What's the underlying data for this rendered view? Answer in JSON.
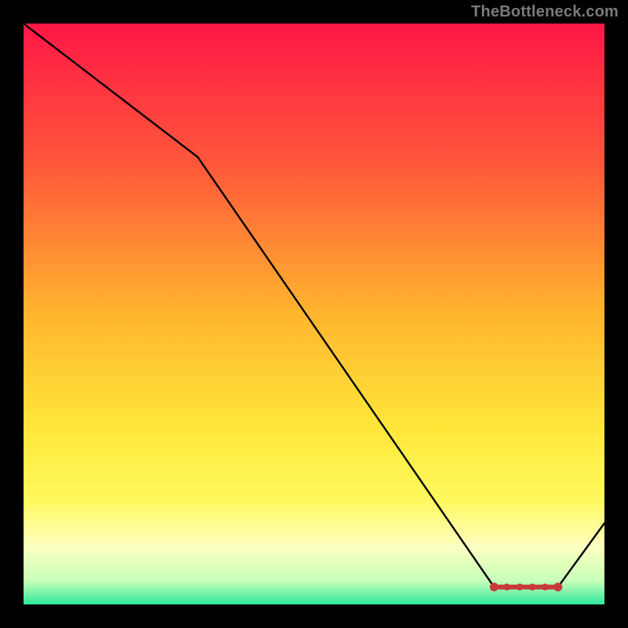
{
  "watermark": "TheBottleneck.com",
  "chart_data": {
    "type": "line",
    "title": "",
    "xlabel": "",
    "ylabel": "",
    "xlim": [
      0,
      100
    ],
    "ylim": [
      0,
      100
    ],
    "grid": false,
    "series": [
      {
        "name": "curve",
        "color": "#000000",
        "x": [
          0,
          30,
          81,
          92,
          100
        ],
        "y": [
          100,
          77,
          3,
          3,
          14
        ]
      },
      {
        "name": "markers",
        "color": "#c83a3a",
        "kind": "capsule",
        "x_range": [
          81,
          92
        ],
        "y": 3
      }
    ],
    "background_gradient": {
      "stops": [
        {
          "offset": 0.0,
          "color": "#ff1746"
        },
        {
          "offset": 0.25,
          "color": "#ff5a3a"
        },
        {
          "offset": 0.5,
          "color": "#ffb52e"
        },
        {
          "offset": 0.7,
          "color": "#ffe83a"
        },
        {
          "offset": 0.82,
          "color": "#fff95e"
        },
        {
          "offset": 0.9,
          "color": "#fdffc0"
        },
        {
          "offset": 0.96,
          "color": "#c6ffb8"
        },
        {
          "offset": 1.0,
          "color": "#2de89b"
        }
      ]
    }
  }
}
